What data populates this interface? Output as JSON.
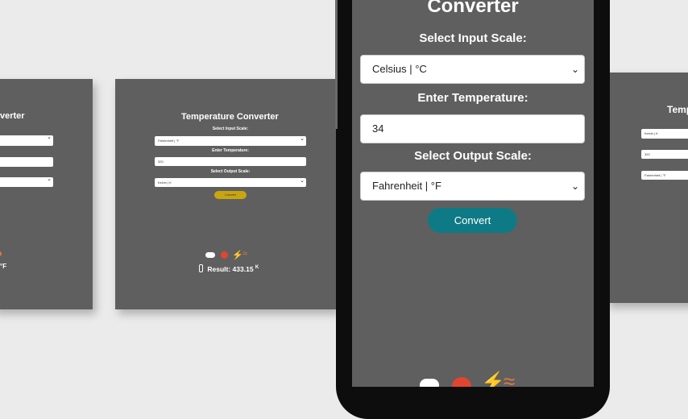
{
  "app": {
    "title": "Temperature Converter",
    "title_partial_left": "verter",
    "title_partial_right": "Temp",
    "title_phone": "Converter",
    "labels": {
      "input_scale": "Select Input Scale:",
      "enter_temp": "Enter Temperature:",
      "output_scale": "Select Output Scale:"
    },
    "convert_label": "Convert"
  },
  "panel_center": {
    "input_scale_value": "Fahrenheit | °F",
    "temperature_value": "320",
    "output_scale_value": "Kelvin | K",
    "result_label": "Result: 433.15",
    "result_unit": "K"
  },
  "panel_left": {
    "result_unit": "°F"
  },
  "panel_right": {
    "input_scale_value": "Kelvin | K",
    "temperature_value": "320",
    "output_scale_value": "Fahrenheit | °F"
  },
  "phone": {
    "input_scale_value": "Celsius | °C",
    "temperature_value": "34",
    "output_scale_value": "Fahrenheit | °F"
  },
  "icons": [
    "cloud-icon",
    "sun-icon",
    "lightning-icon",
    "wind-icon",
    "thermometer-icon"
  ],
  "colors": {
    "panel_bg": "#5f5f5f",
    "convert_button": "#0e7a85",
    "mini_convert_button": "#c9a510",
    "sun": "#e2452f",
    "lightning": "#f0c419",
    "wind": "#e07b3c",
    "cloud": "#ffffff"
  }
}
